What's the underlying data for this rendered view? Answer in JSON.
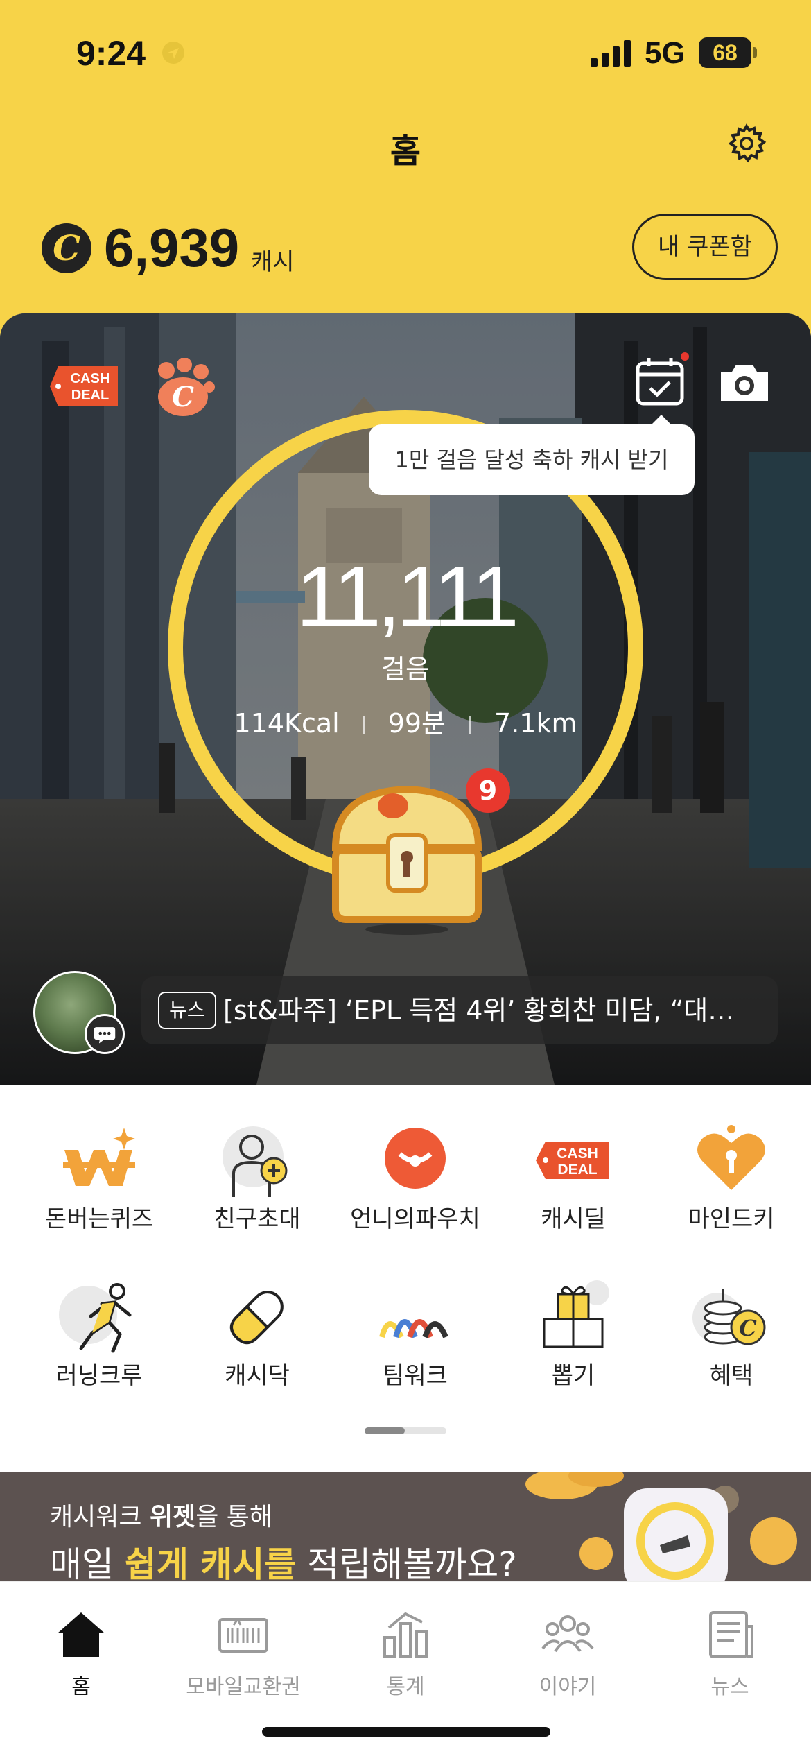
{
  "status_bar": {
    "time": "9:24",
    "network": "5G",
    "battery": "68"
  },
  "header": {
    "title": "홈"
  },
  "cash": {
    "icon_letter": "C",
    "amount": "6,939",
    "unit": "캐시",
    "coupon_button": "내 쿠폰함"
  },
  "hero": {
    "cashdeal_tag": [
      "CASH",
      "DEAL"
    ],
    "tooltip": "1만 걸음 달성 축하 캐시 받기",
    "steps": "11,111",
    "steps_label": "걸음",
    "calories": "114Kcal",
    "minutes": "99분",
    "distance": "7.1km",
    "chest_badge": "9",
    "news_tag": "뉴스",
    "news_text": "[st&파주] ‘EPL 득점 4위’ 황희찬 미담, “대…"
  },
  "menu": [
    {
      "label": "돈버는퀴즈",
      "icon": "quiz-icon"
    },
    {
      "label": "친구초대",
      "icon": "invite-friend-icon"
    },
    {
      "label": "언니의파우치",
      "icon": "pouch-icon"
    },
    {
      "label": "캐시딜",
      "icon": "cashdeal-icon"
    },
    {
      "label": "마인드키",
      "icon": "mindkey-icon"
    },
    {
      "label": "러닝크루",
      "icon": "running-crew-icon"
    },
    {
      "label": "캐시닥",
      "icon": "pill-icon"
    },
    {
      "label": "팀워크",
      "icon": "teamwork-icon"
    },
    {
      "label": "뽑기",
      "icon": "gift-draw-icon"
    },
    {
      "label": "혜택",
      "icon": "benefit-coins-icon"
    }
  ],
  "promo": {
    "line1_prefix": "캐시워크 ",
    "line1_bold": "위젯",
    "line1_suffix": "을 통해",
    "line2_prefix": "매일 ",
    "line2_bold": "쉽게 캐시를",
    "line2_suffix": " 적립해볼까요?"
  },
  "bottom_nav": [
    {
      "label": "홈",
      "active": true
    },
    {
      "label": "모바일교환권",
      "active": false
    },
    {
      "label": "통계",
      "active": false
    },
    {
      "label": "이야기",
      "active": false
    },
    {
      "label": "뉴스",
      "active": false
    }
  ],
  "colors": {
    "brand_yellow": "#f7d348",
    "badge_red": "#e8382e",
    "promo_bg": "#5c5250"
  }
}
